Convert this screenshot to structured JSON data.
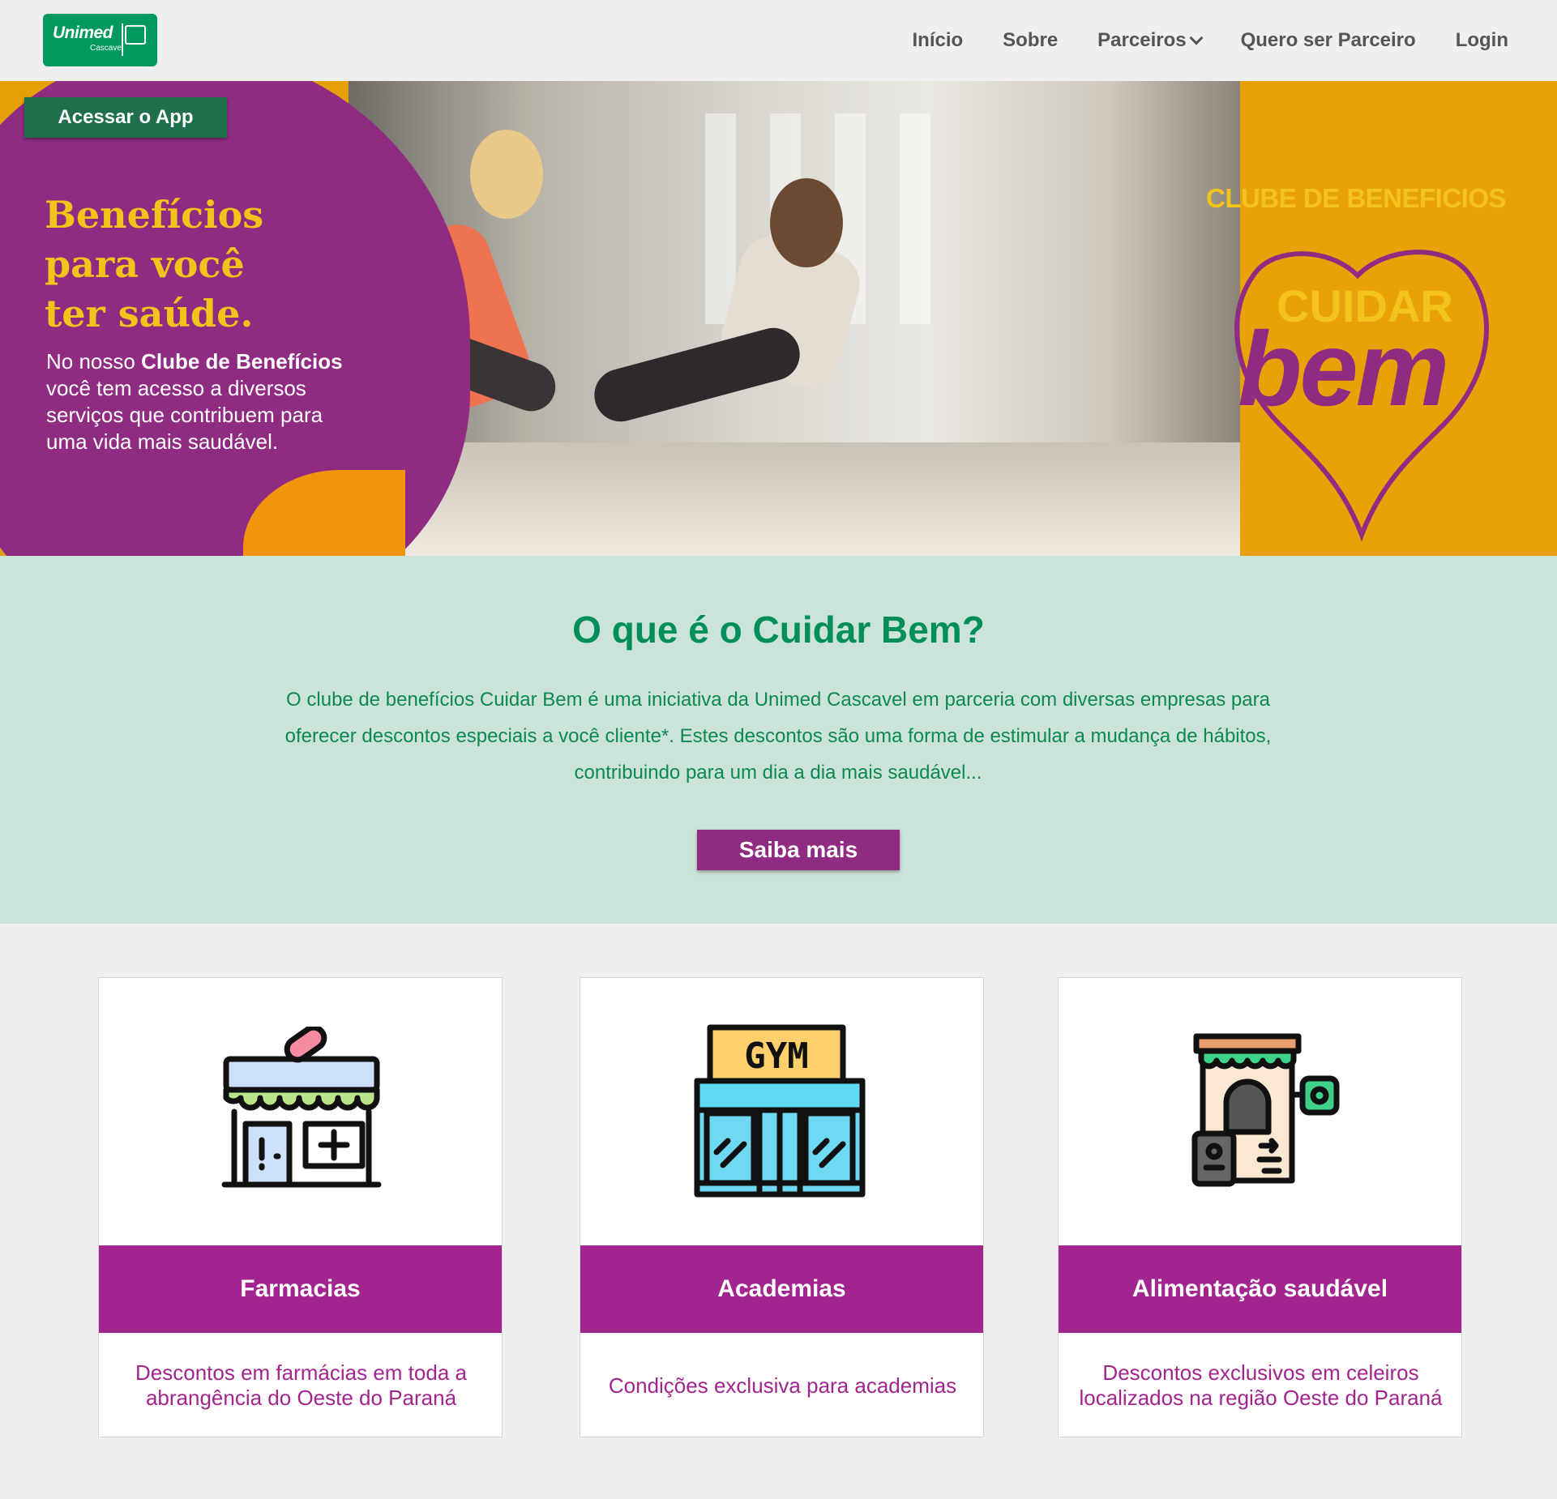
{
  "nav": {
    "logo_text": "Unimed",
    "logo_sub": "Cascavel",
    "links": [
      {
        "label": "Início"
      },
      {
        "label": "Sobre"
      },
      {
        "label": "Parceiros"
      },
      {
        "label": "Quero ser Parceiro"
      },
      {
        "label": "Login"
      }
    ]
  },
  "hero": {
    "app_button": "Acessar o App",
    "title_line1": "Benefícios",
    "title_line2": "para você",
    "title_line3": "ter saúde.",
    "text_pre": "No nosso ",
    "text_bold": "Clube de Benefícios",
    "text_post": " você tem acesso a diversos serviços que contribuem para uma vida mais saudável.",
    "clube_label": "CLUBE DE BENEFICIOS",
    "brand_top": "CUIDAR",
    "brand_bottom": "bem"
  },
  "about": {
    "title": "O que é o Cuidar Bem?",
    "text": "O clube de benefícios Cuidar Bem é uma iniciativa da Unimed Cascavel em parceria com diversas empresas para oferecer descontos especiais a você cliente*. Estes descontos são uma forma de estimular a mudança de hábitos, contribuindo para um dia a dia mais saudável...",
    "button": "Saiba mais"
  },
  "cards": [
    {
      "icon": "pharmacy-icon",
      "title": "Farmacias",
      "desc": "Descontos em farmácias em toda a abrangência do Oeste do Paraná"
    },
    {
      "icon": "gym-icon",
      "title": "Academias",
      "desc": "Condições exclusiva para academias",
      "icon_text": "GYM"
    },
    {
      "icon": "organic-store-icon",
      "title": "Alimentação saudável",
      "desc": "Descontos exclusivos em celeiros localizados na região Oeste do Paraná"
    }
  ],
  "colors": {
    "green": "#00995d",
    "purple": "#a2248e",
    "hero_purple": "#8f2c82",
    "yellow": "#f3c21b",
    "orange": "#e8a106",
    "mint": "#cce3d9"
  }
}
